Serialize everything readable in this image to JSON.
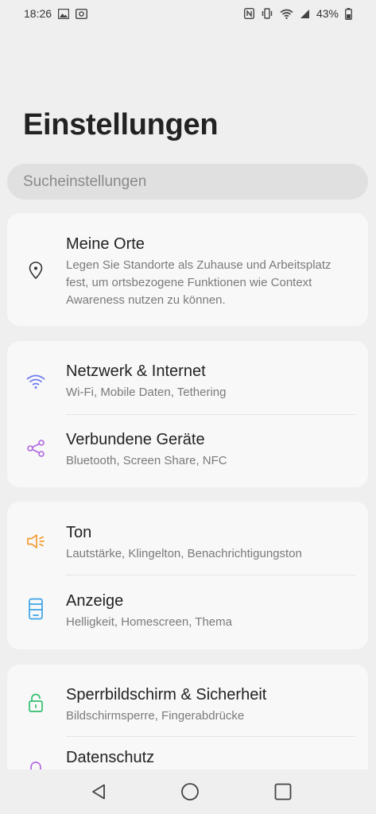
{
  "status_bar": {
    "time": "18:26",
    "battery": "43%",
    "left_icons": [
      "gallery-icon",
      "screenshot-icon"
    ],
    "right_icons": [
      "nfc-icon",
      "vibrate-icon",
      "wifi-icon",
      "signal-icon",
      "battery-icon"
    ]
  },
  "header": {
    "title": "Einstellungen"
  },
  "search": {
    "placeholder": "Sucheinstellungen"
  },
  "cards": [
    {
      "items": [
        {
          "title": "Meine Orte",
          "subtitle": "Legen Sie Standorte als Zuhause und Arbeitsplatz fest, um ortsbezogene Funktionen wie Context Awareness nutzen zu können.",
          "icon": "location-pin-icon",
          "icon_color": "#333333"
        }
      ]
    },
    {
      "items": [
        {
          "title": "Netzwerk & Internet",
          "subtitle": "Wi-Fi, Mobile Daten, Tethering",
          "icon": "wifi-icon",
          "icon_color": "#6e7cf0"
        },
        {
          "title": "Verbundene Geräte",
          "subtitle": "Bluetooth, Screen Share, NFC",
          "icon": "share-icon",
          "icon_color": "#b066e0"
        }
      ]
    },
    {
      "items": [
        {
          "title": "Ton",
          "subtitle": "Lautstärke, Klingelton, Benachrichtigungston",
          "icon": "speaker-icon",
          "icon_color": "#f39a2c"
        },
        {
          "title": "Anzeige",
          "subtitle": "Helligkeit, Homescreen, Thema",
          "icon": "display-icon",
          "icon_color": "#3ba3e8"
        }
      ]
    },
    {
      "items": [
        {
          "title": "Sperrbildschirm & Sicherheit",
          "subtitle": "Bildschirmsperre, Fingerabdrücke",
          "icon": "lock-icon",
          "icon_color": "#2fbf6e"
        },
        {
          "title": "Datenschutz",
          "icon": "privacy-icon",
          "icon_color": "#b066e0"
        }
      ]
    }
  ],
  "nav_bar": {
    "buttons": [
      "back-icon",
      "home-icon",
      "recents-icon"
    ]
  }
}
